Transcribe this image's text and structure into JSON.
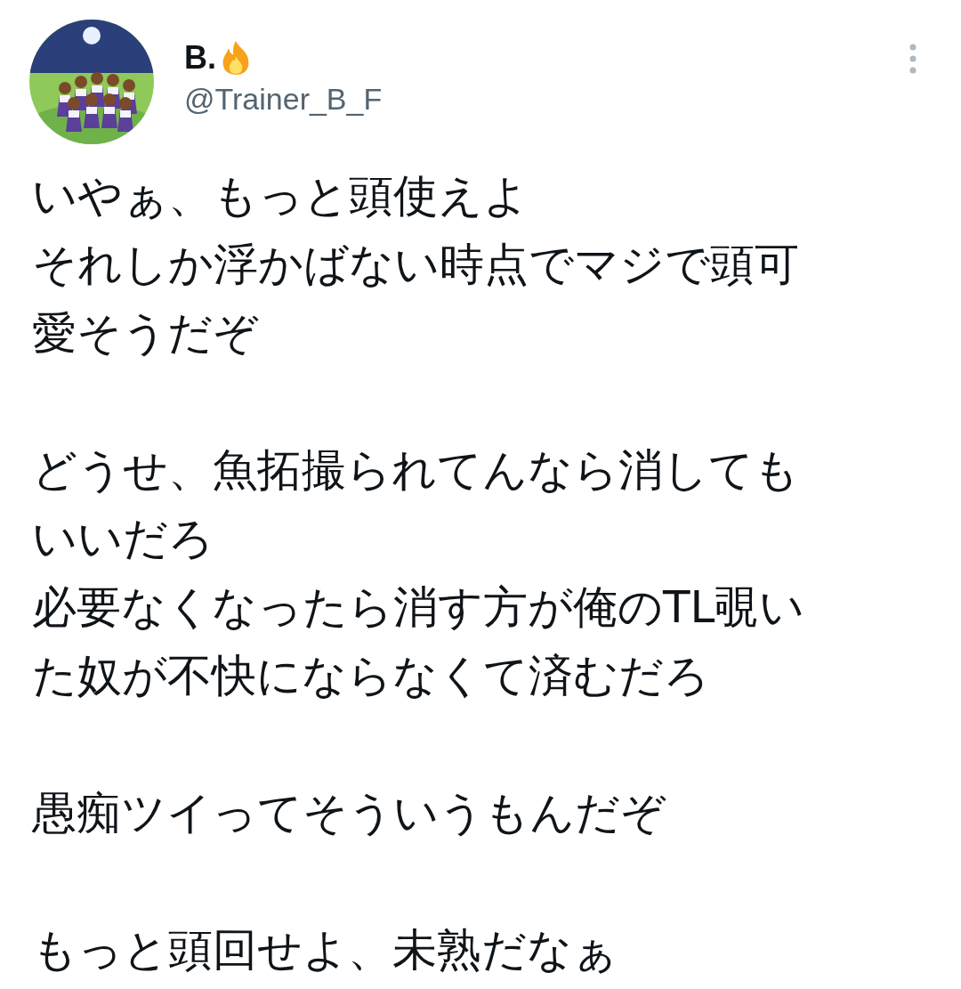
{
  "author": {
    "name": "B.",
    "handle": "@Trainer_B_F"
  },
  "paragraphs": [
    {
      "lines": [
        "いやぁ、もっと頭使えよ",
        "それしか浮かばない時点でマジで頭可",
        "愛そうだぞ"
      ]
    },
    {
      "lines": [
        "どうせ、魚拓撮られてんなら消しても",
        "いいだろ",
        "必要なくなったら消す方が俺のTL覗い",
        "た奴が不快にならなくて済むだろ"
      ]
    },
    {
      "lines": [
        "愚痴ツイってそういうもんだぞ"
      ]
    },
    {
      "lines": [
        "もっと頭回せよ、未熟だなぁ"
      ]
    }
  ]
}
